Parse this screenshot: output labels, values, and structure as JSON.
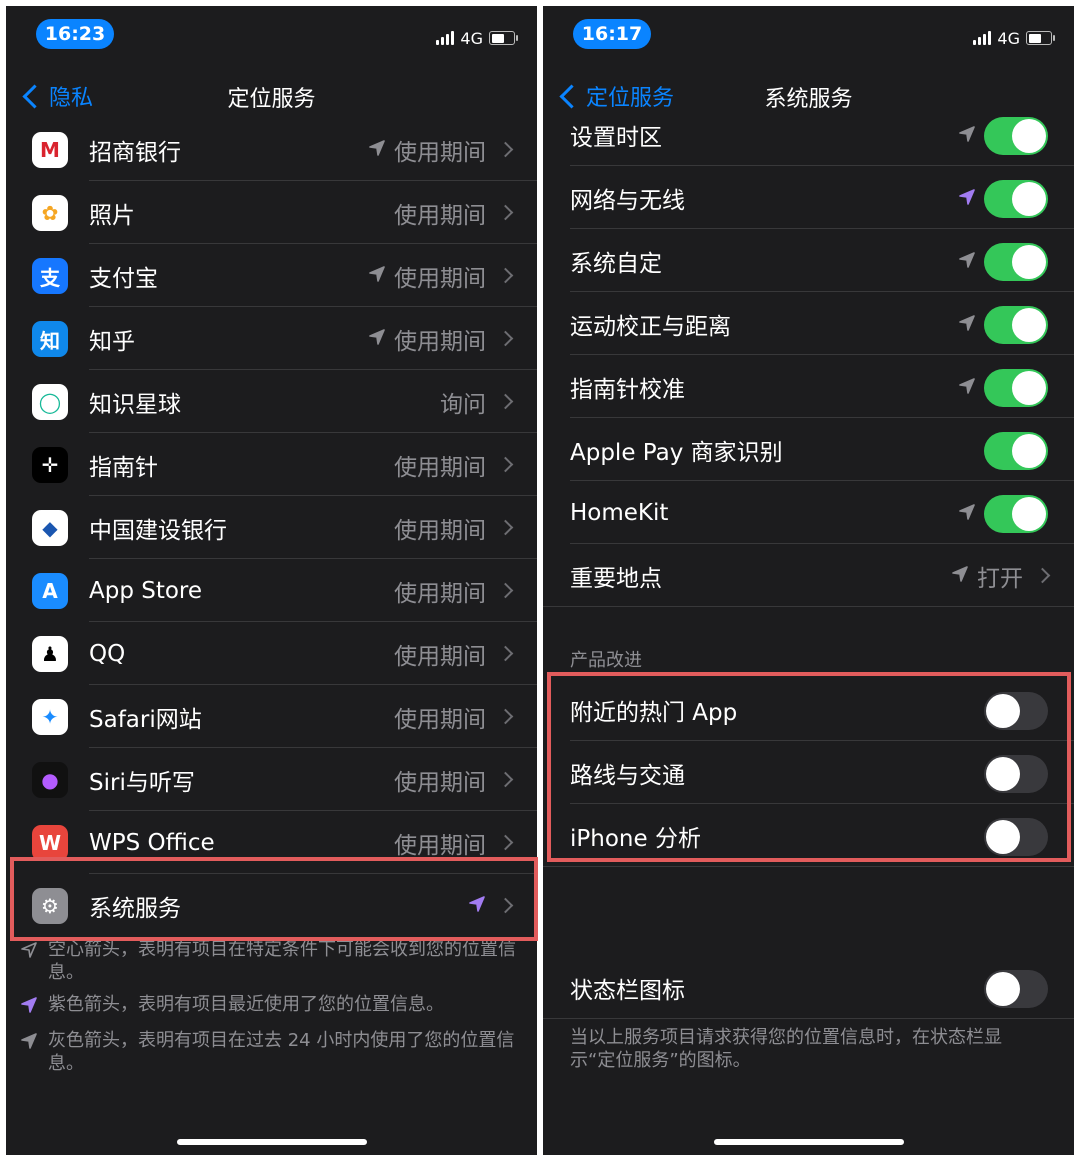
{
  "left": {
    "time": "16:23",
    "network": "4G",
    "back_label": "隐私",
    "title": "定位服务",
    "apps": [
      {
        "name": "招商银行",
        "status": "使用期间",
        "arrow": "gray",
        "icon": "cmb-icon",
        "color": "#ffffff",
        "glyph": "M",
        "glyph_color": "#d9232e"
      },
      {
        "name": "照片",
        "status": "使用期间",
        "arrow": "",
        "icon": "photos-icon",
        "color": "#ffffff",
        "glyph": "✿",
        "glyph_color": "#f5a623"
      },
      {
        "name": "支付宝",
        "status": "使用期间",
        "arrow": "gray",
        "icon": "alipay-icon",
        "color": "#1677ff",
        "glyph": "支",
        "glyph_color": "#ffffff"
      },
      {
        "name": "知乎",
        "status": "使用期间",
        "arrow": "gray",
        "icon": "zhihu-icon",
        "color": "#0f88eb",
        "glyph": "知",
        "glyph_color": "#ffffff"
      },
      {
        "name": "知识星球",
        "status": "询问",
        "arrow": "",
        "icon": "zsxq-icon",
        "color": "#ffffff",
        "glyph": "◯",
        "glyph_color": "#16b998"
      },
      {
        "name": "指南针",
        "status": "使用期间",
        "arrow": "",
        "icon": "compass-icon",
        "color": "#000000",
        "glyph": "✛",
        "glyph_color": "#ffffff"
      },
      {
        "name": "中国建设银行",
        "status": "使用期间",
        "arrow": "",
        "icon": "ccb-icon",
        "color": "#ffffff",
        "glyph": "◆",
        "glyph_color": "#1a56b0"
      },
      {
        "name": "App Store",
        "status": "使用期间",
        "arrow": "",
        "icon": "appstore-icon",
        "color": "#1a8cff",
        "glyph": "A",
        "glyph_color": "#ffffff"
      },
      {
        "name": "QQ",
        "status": "使用期间",
        "arrow": "",
        "icon": "qq-icon",
        "color": "#ffffff",
        "glyph": "♟",
        "glyph_color": "#000000"
      },
      {
        "name": "Safari网站",
        "status": "使用期间",
        "arrow": "",
        "icon": "safari-icon",
        "color": "#ffffff",
        "glyph": "✦",
        "glyph_color": "#1a8cff"
      },
      {
        "name": "Siri与听写",
        "status": "使用期间",
        "arrow": "",
        "icon": "siri-icon",
        "color": "#111111",
        "glyph": "●",
        "glyph_color": "#b45cff"
      },
      {
        "name": "WPS Office",
        "status": "使用期间",
        "arrow": "",
        "icon": "wps-icon",
        "color": "#e8453c",
        "glyph": "W",
        "glyph_color": "#ffffff"
      },
      {
        "name": "系统服务",
        "status": "",
        "arrow": "purple",
        "icon": "settings-icon",
        "color": "#8e8e93",
        "glyph": "⚙",
        "glyph_color": "#ffffff"
      }
    ],
    "notes": [
      {
        "icon": "hollow",
        "text": "空心箭头，表明有项目在特定条件下可能会收到您的位置信息。"
      },
      {
        "icon": "purple",
        "text": "紫色箭头，表明有项目最近使用了您的位置信息。"
      },
      {
        "icon": "gray",
        "text": "灰色箭头，表明有项目在过去 24 小时内使用了您的位置信息。"
      }
    ]
  },
  "right": {
    "time": "16:17",
    "network": "4G",
    "back_label": "定位服务",
    "title": "系统服务",
    "services": [
      {
        "name": "设置时区",
        "arrow": "gray",
        "on": true
      },
      {
        "name": "网络与无线",
        "arrow": "purple",
        "on": true
      },
      {
        "name": "系统自定",
        "arrow": "gray",
        "on": true
      },
      {
        "name": "运动校正与距离",
        "arrow": "gray",
        "on": true
      },
      {
        "name": "指南针校准",
        "arrow": "gray",
        "on": true
      },
      {
        "name": "Apple Pay 商家识别",
        "arrow": "",
        "on": true
      },
      {
        "name": "HomeKit",
        "arrow": "gray",
        "on": true
      }
    ],
    "important_places": {
      "name": "重要地点",
      "status": "打开"
    },
    "section_header": "产品改进",
    "improvements": [
      {
        "name": "附近的热门 App",
        "on": false
      },
      {
        "name": "路线与交通",
        "on": false
      },
      {
        "name": "iPhone 分析",
        "on": false
      }
    ],
    "status_bar_icon": {
      "name": "状态栏图标",
      "on": false
    },
    "footer": "当以上服务项目请求获得您的位置信息时，在状态栏显示“定位服务”的图标。"
  },
  "colors": {
    "accent": "#0a84ff",
    "toggle_on": "#34c759",
    "highlight": "#e25c5c",
    "purple_arrow": "#a27cf2"
  }
}
